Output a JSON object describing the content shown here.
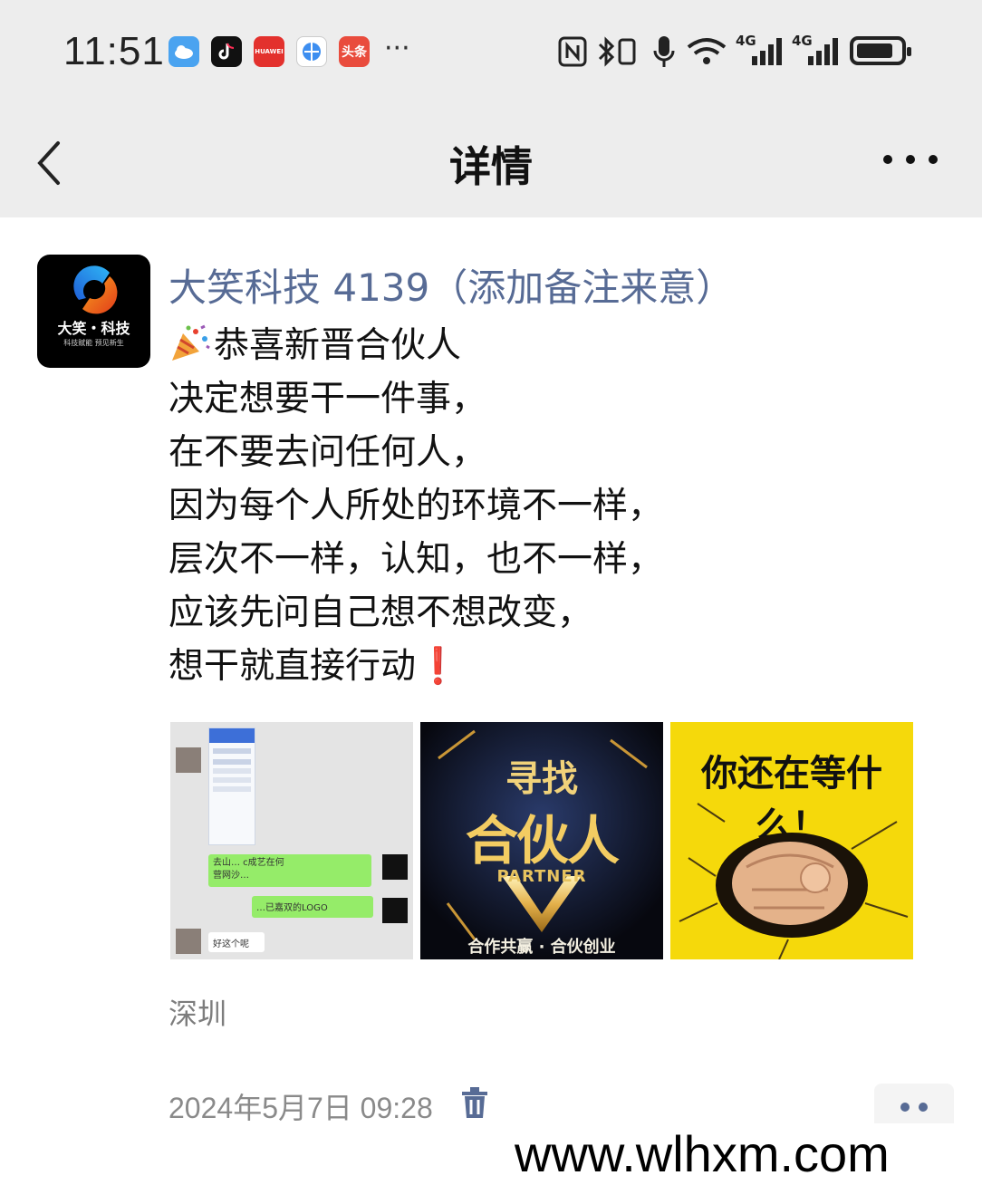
{
  "status_bar": {
    "time": "11:51",
    "app_icons": [
      "weather-icon",
      "tiktok-icon",
      "huawei-icon",
      "browser-icon",
      "toutiao-icon"
    ],
    "huawei_label": "HUAWEI",
    "toutiao_label": "头条",
    "overflow": "···",
    "signal_1": "4G",
    "signal_2": "4G",
    "battery_level": 0.85
  },
  "nav": {
    "title": "详情"
  },
  "post": {
    "avatar_name": "大笑・科技",
    "avatar_sub": "科技赋能  预见新生",
    "username": "大笑科技 4139（添加备注来意）",
    "lines": [
      "恭喜新晋合伙人",
      "决定想要干一件事，",
      "在不要去问任何人，",
      "因为每个人所处的环境不一样，",
      "层次不一样，认知，也不一样，",
      "应该先问自己想不想改变，",
      "想干就直接行动"
    ],
    "exclamation": "❗",
    "images": [
      {
        "name": "chat-screenshot",
        "bubble_1": "去山…  c成艺在何",
        "bubble_1b": "营网沙…",
        "bubble_2": "…已嘉双的LOGO",
        "bubble_3": "好这个呢"
      },
      {
        "name": "partner-poster",
        "top": "寻找",
        "big": "合伙人",
        "mid": "PARTNER",
        "bottom": "合作共赢 · 合伙创业"
      },
      {
        "name": "pointing-fist-poster",
        "headline": "你还在等什么！"
      }
    ],
    "location": "深圳",
    "timestamp": "2024年5月7日 09:28"
  },
  "watermark": "www.wlhxm.com",
  "colors": {
    "link": "#576b95",
    "header_bg": "#ededed",
    "excl": "#e02020"
  }
}
